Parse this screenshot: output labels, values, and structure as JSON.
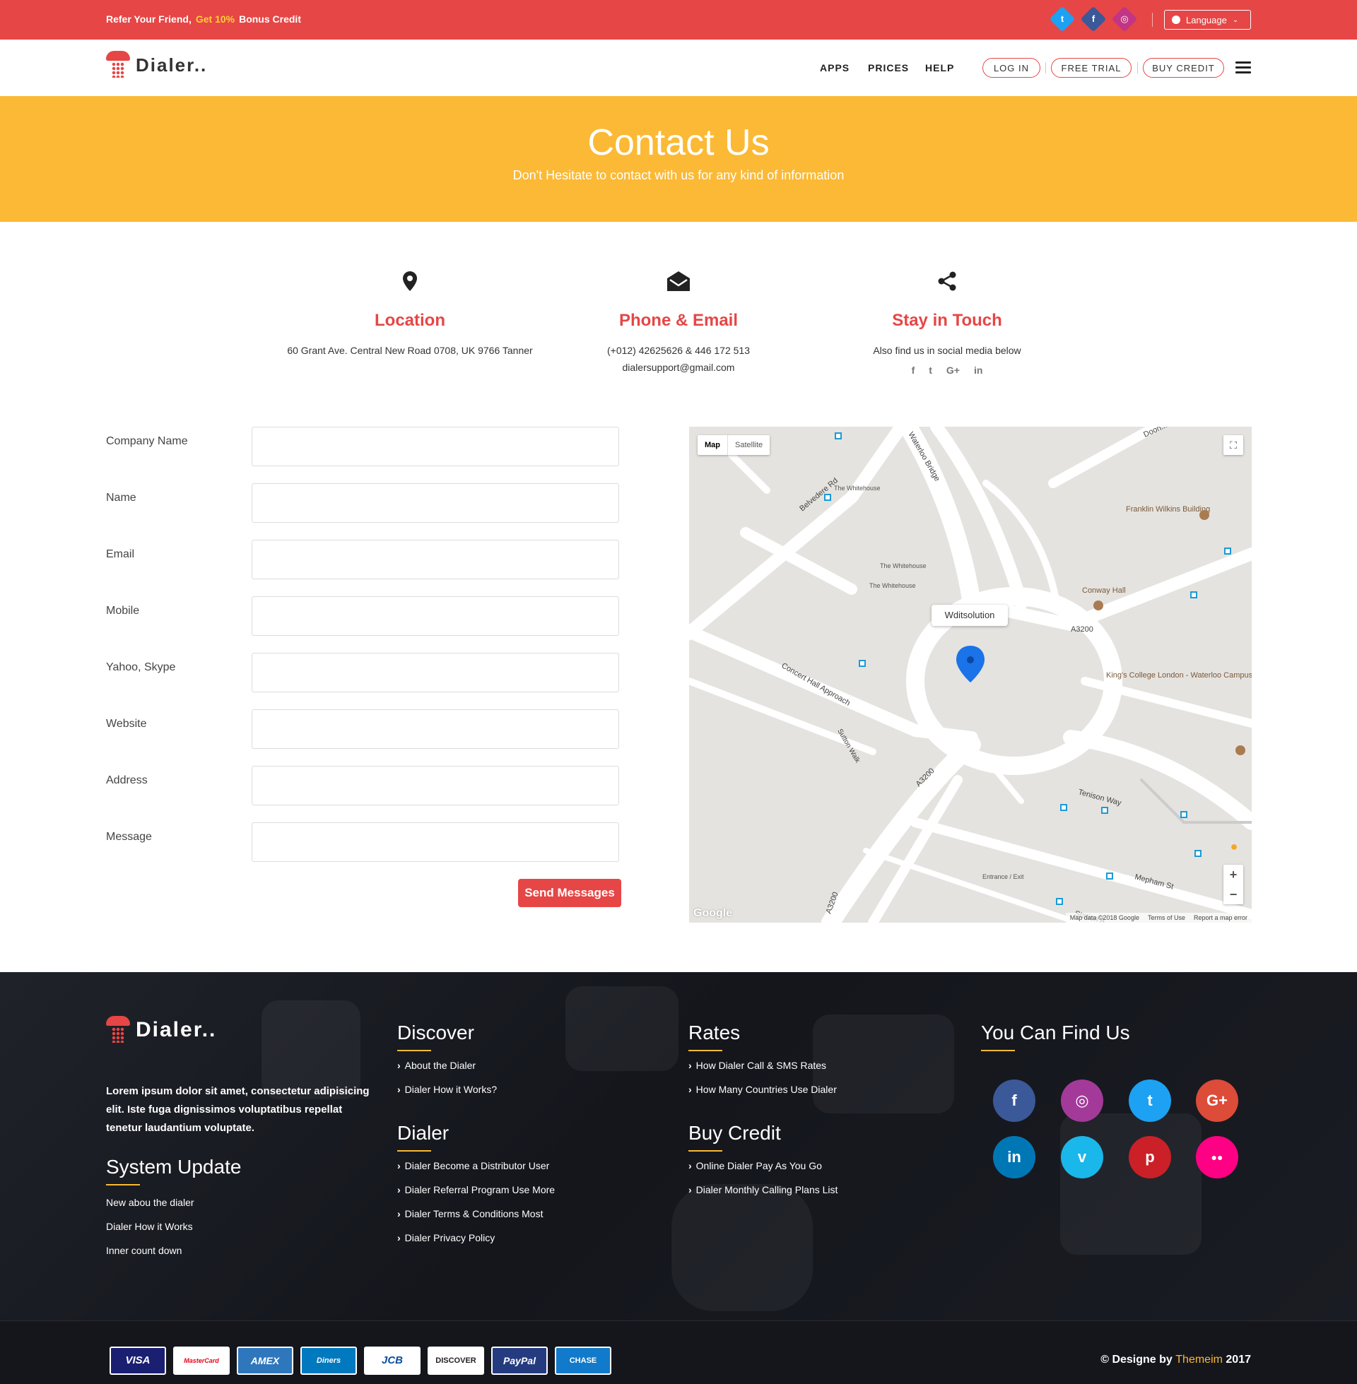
{
  "topbar": {
    "refer_prefix": "Refer Your Friend,",
    "refer_highlight": "Get 10%",
    "refer_suffix": "Bonus Credit",
    "social": [
      {
        "icon": "twitter-icon",
        "glyph": "t",
        "color": "#1da1f2"
      },
      {
        "icon": "facebook-icon",
        "glyph": "f",
        "color": "#3b5998"
      },
      {
        "icon": "instagram-icon",
        "glyph": "◎",
        "color": "#c13584"
      }
    ],
    "language_label": "Language"
  },
  "nav": {
    "logo_text": "Dialer..",
    "links": [
      "APPS",
      "PRICES",
      "HELP"
    ],
    "login": "LOG IN",
    "free_trial": "FREE TRIAL",
    "buy_credit": "BUY CREDIT"
  },
  "hero": {
    "title": "Contact Us",
    "subtitle": "Don't Hesitate to contact with us for any kind of information"
  },
  "info": {
    "location": {
      "title": "Location",
      "line1": "60 Grant Ave. Central New Road 0708, UK 9766 Tanner"
    },
    "phone": {
      "title": "Phone & Email",
      "line1": "(+012) 42625626 & 446 172 513",
      "line2": "dialersupport@gmail.com"
    },
    "touch": {
      "title": "Stay in Touch",
      "line1": "Also find us in social media below",
      "social": [
        "f",
        "t",
        "G+",
        "in"
      ]
    }
  },
  "form": {
    "fields": [
      "Company Name",
      "Name",
      "Email",
      "Mobile",
      "Yahoo, Skype",
      "Website",
      "Address",
      "Message"
    ],
    "submit": "Send Messages"
  },
  "map": {
    "type_map": "Map",
    "type_satellite": "Satellite",
    "marker_label": "Wditsolution",
    "roads": [
      "Belvedere Rd",
      "Waterloo Bridge",
      "Concert Hall Approach",
      "Sutton Walk",
      "A3200",
      "A3200",
      "A3200",
      "Tenison Way",
      "Mepham St",
      "Station A...",
      "Doon..."
    ],
    "places": [
      "The Whitehouse",
      "The Whitehouse",
      "The Whitehouse",
      "Franklin Wilkins Building",
      "Conway Hall",
      "King's College London - Waterloo Campus",
      "Entrance / Exit"
    ],
    "footer": [
      "Map data ©2018 Google",
      "Terms of Use",
      "Report a map error"
    ],
    "google": "Google"
  },
  "footer": {
    "logo_text": "Dialer..",
    "desc": "Lorem ipsum dolor sit amet, consectetur adipisicing elit. Iste fuga dignissimos voluptatibus repellat tenetur laudantium voluptate.",
    "system_update": {
      "title": "System Update",
      "items": [
        "New abou the dialer",
        "Dialer How it Works",
        "Inner count down"
      ]
    },
    "discover": {
      "title": "Discover",
      "items": [
        "About the Dialer",
        "Dialer How it Works?"
      ]
    },
    "dialer": {
      "title": "Dialer",
      "items": [
        "Dialer Become a Distributor User",
        "Dialer Referral Program Use More",
        "Dialer Terms & Conditions Most",
        "Dialer Privacy Policy"
      ]
    },
    "rates": {
      "title": "Rates",
      "items": [
        "How Dialer Call & SMS Rates",
        "How Many Countries Use Dialer"
      ]
    },
    "buy_credit": {
      "title": "Buy Credit",
      "items": [
        "Online Dialer Pay As You Go",
        "Dialer Monthly Calling Plans List"
      ]
    },
    "find_us": {
      "title": "You Can Find Us",
      "social": [
        {
          "icon": "facebook-icon",
          "glyph": "f",
          "color": "#3b5998"
        },
        {
          "icon": "instagram-icon",
          "glyph": "◎",
          "color": "#a33a9a"
        },
        {
          "icon": "twitter-icon",
          "glyph": "t",
          "color": "#1da1f2"
        },
        {
          "icon": "google-plus-icon",
          "glyph": "G+",
          "color": "#dd4b39"
        },
        {
          "icon": "linkedin-icon",
          "glyph": "in",
          "color": "#0077b5"
        },
        {
          "icon": "vimeo-icon",
          "glyph": "v",
          "color": "#1ab7ea"
        },
        {
          "icon": "pinterest-icon",
          "glyph": "p",
          "color": "#cb2027"
        },
        {
          "icon": "flickr-icon",
          "glyph": "●●",
          "color": "#ff0084"
        }
      ]
    }
  },
  "payments": [
    {
      "name": "VISA",
      "color": "#1a1f71"
    },
    {
      "name": "MasterCard",
      "color": "#ffffff"
    },
    {
      "name": "AMEX",
      "color": "#2e77bc"
    },
    {
      "name": "Diners",
      "color": "#0079be"
    },
    {
      "name": "JCB",
      "color": "#ffffff"
    },
    {
      "name": "DISCOVER",
      "color": "#ffffff"
    },
    {
      "name": "PayPal",
      "color": "#253b80"
    },
    {
      "name": "CHASE",
      "color": "#117aca"
    }
  ],
  "copyright": {
    "prefix": "© Designe by",
    "brand": "Themeim",
    "year": "2017"
  }
}
